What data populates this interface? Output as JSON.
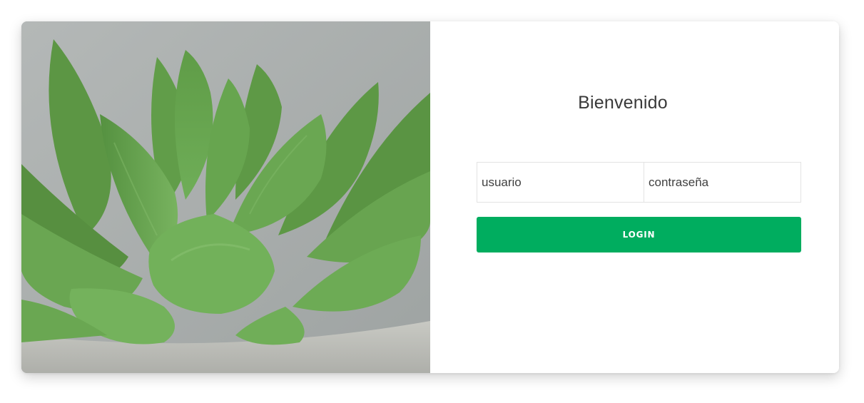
{
  "login": {
    "title": "Bienvenido",
    "username_placeholder": "usuario",
    "password_placeholder": "contraseña",
    "submit_label": "LOGIN"
  },
  "colors": {
    "accent": "#00ad5f",
    "photo_background": "#a9aeae",
    "leaf_green": "#6aa552"
  },
  "image": {
    "subject": "succulent-plant-photo"
  }
}
